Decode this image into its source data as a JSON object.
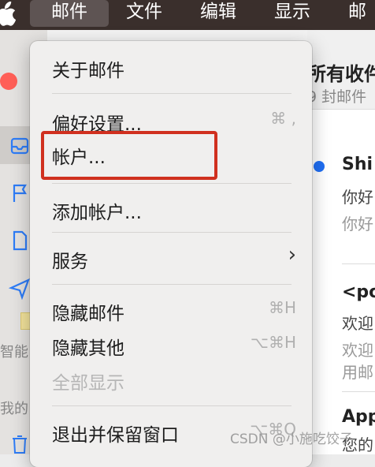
{
  "menubar": {
    "items": [
      {
        "label": "邮件",
        "active": true
      },
      {
        "label": "文件"
      },
      {
        "label": "编辑"
      },
      {
        "label": "显示"
      },
      {
        "label": "邮"
      }
    ]
  },
  "menu": {
    "items": [
      {
        "label": "关于邮件"
      },
      {
        "label": "偏好设置...",
        "shortcut": "⌘ ,"
      },
      {
        "label": "帐户..."
      },
      {
        "label": "添加帐户..."
      },
      {
        "label": "服务",
        "submenu_indicator": "›"
      },
      {
        "label": "隐藏邮件",
        "shortcut": "⌘H"
      },
      {
        "label": "隐藏其他",
        "shortcut": "⌥⌘H"
      },
      {
        "label": "全部显示",
        "disabled": true
      },
      {
        "label": "退出并保留窗口",
        "shortcut": "⌥⌘Q"
      }
    ]
  },
  "sidebar": {
    "labels": [
      "智能",
      "我的"
    ]
  },
  "mail_list": {
    "title": "所有收件",
    "subtitle": "9 封邮件",
    "messages": [
      {
        "sender": "Shi",
        "lines": [
          "你好",
          "你好"
        ],
        "unread": true
      },
      {
        "sender": "<po",
        "lines": [
          "欢迎",
          "欢迎",
          "用邮"
        ]
      },
      {
        "sender": "App",
        "lines": [
          "您的"
        ]
      }
    ]
  },
  "watermark": "CSDN @小施吃饺子",
  "colors": {
    "menubar": "#3a2f2c",
    "highlight_box": "#d0301f",
    "unread_dot": "#1f6ef3"
  }
}
